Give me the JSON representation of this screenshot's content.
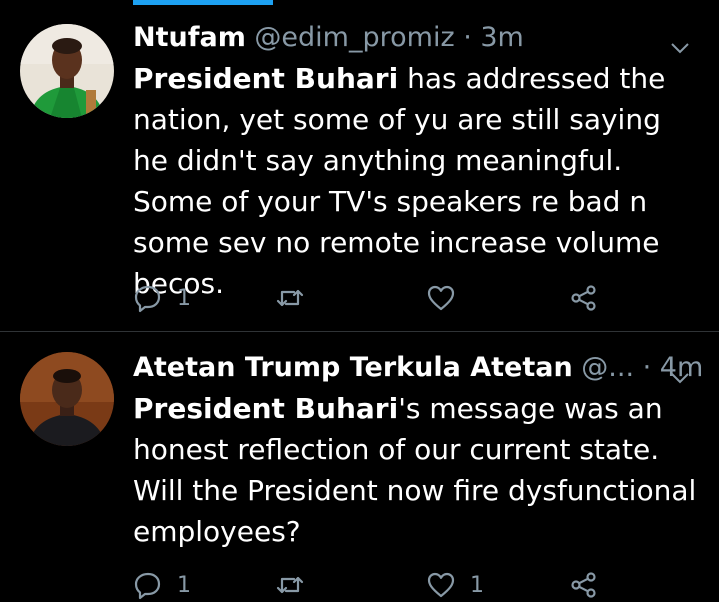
{
  "tweets": [
    {
      "display_name": "Ntufam",
      "handle": "@edim_promiz",
      "time": "3m",
      "body_bold": "President Buhari",
      "body_rest": " has addressed the nation, yet some of yu are still saying he didn't say anything meaningful. Some of your TV's speakers re bad n some sev no remote increase volume becos.",
      "reply_count": "1",
      "retweet_count": "",
      "like_count": ""
    },
    {
      "display_name": "Atetan Trump Terkula Atetan",
      "handle": "@...",
      "time": "4m",
      "body_bold": "President Buhari",
      "body_rest": "'s message was an honest reflection of our current state. Will the President now fire dysfunctional employees?",
      "reply_count": "1",
      "retweet_count": "",
      "like_count": "1"
    }
  ],
  "separator": " · ",
  "icons": {
    "reply": "reply-icon",
    "retweet": "retweet-icon",
    "like": "heart-icon",
    "share": "share-icon",
    "menu": "chevron-down-icon"
  },
  "colors": {
    "background": "#000000",
    "text": "#ffffff",
    "secondary": "#8899a6",
    "accent": "#1da1f2",
    "divider": "#2f3336"
  }
}
